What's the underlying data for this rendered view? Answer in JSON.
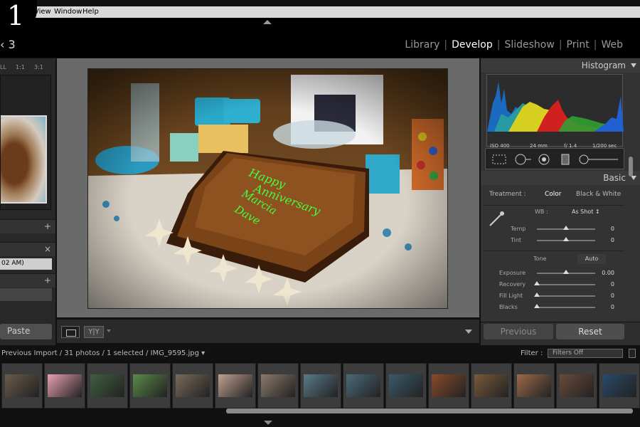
{
  "window": {
    "corner_number": "1"
  },
  "menubar": {
    "items": [
      "View",
      "Window",
      "Help"
    ]
  },
  "header": {
    "identity_text": "‹ 3"
  },
  "modules": {
    "items": [
      "Library",
      "Develop",
      "Slideshow",
      "Print",
      "Web"
    ],
    "active": "Develop"
  },
  "left_panel": {
    "zoom": [
      "LL",
      "1:1",
      "3:1"
    ],
    "history_value": "02 AM)",
    "paste_label": "Paste",
    "add_glyph": "+",
    "close_glyph": "×"
  },
  "toolbar": {
    "view_mode_icon": "loupe-view-icon",
    "compare_label": "Y|Y"
  },
  "right_panel": {
    "histogram_title": "Histogram",
    "histo_info": {
      "iso": "ISO 400",
      "focal": "24 mm",
      "aperture": "f/ 1.4",
      "shutter": "1/200 sec"
    },
    "basic_title": "Basic",
    "treatment_label": "Treatment :",
    "treatment_color": "Color",
    "treatment_bw": "Black & White",
    "wb_label": "WB :",
    "wb_value": "As Shot ↕",
    "sliders_wb": [
      {
        "label": "Temp",
        "value": "0",
        "pos": 0.5
      },
      {
        "label": "Tint",
        "value": "0",
        "pos": 0.5
      }
    ],
    "tone_label": "Tone",
    "auto_label": "Auto",
    "sliders_tone": [
      {
        "label": "Exposure",
        "value": "0.00",
        "pos": 0.5
      },
      {
        "label": "Recovery",
        "value": "0",
        "pos": 0.0
      },
      {
        "label": "Fill Light",
        "value": "0",
        "pos": 0.0
      },
      {
        "label": "Blacks",
        "value": "0",
        "pos": 0.0
      }
    ],
    "previous_label": "Previous",
    "reset_label": "Reset"
  },
  "filmstrip": {
    "path_text": "Previous Import / 31 photos / 1 selected / IMG_9595.jpg ▾",
    "filter_label": "Filter :",
    "filter_value": "Filters Off",
    "thumb_colors": [
      "#6b5a4a",
      "#e8a0b0",
      "#3f5f3f",
      "#5a8a4a",
      "#7a6a5a",
      "#c0a090",
      "#8a7a6a",
      "#5a7a8a",
      "#4a6a7a",
      "#3a5a6a",
      "#8a4a2a",
      "#7a5a3a",
      "#9a6a4a",
      "#6a4a3a",
      "#2a4a6a"
    ]
  },
  "colors": {
    "accent": "#dddddd",
    "panel": "#333333",
    "text": "#bbbbbb"
  }
}
